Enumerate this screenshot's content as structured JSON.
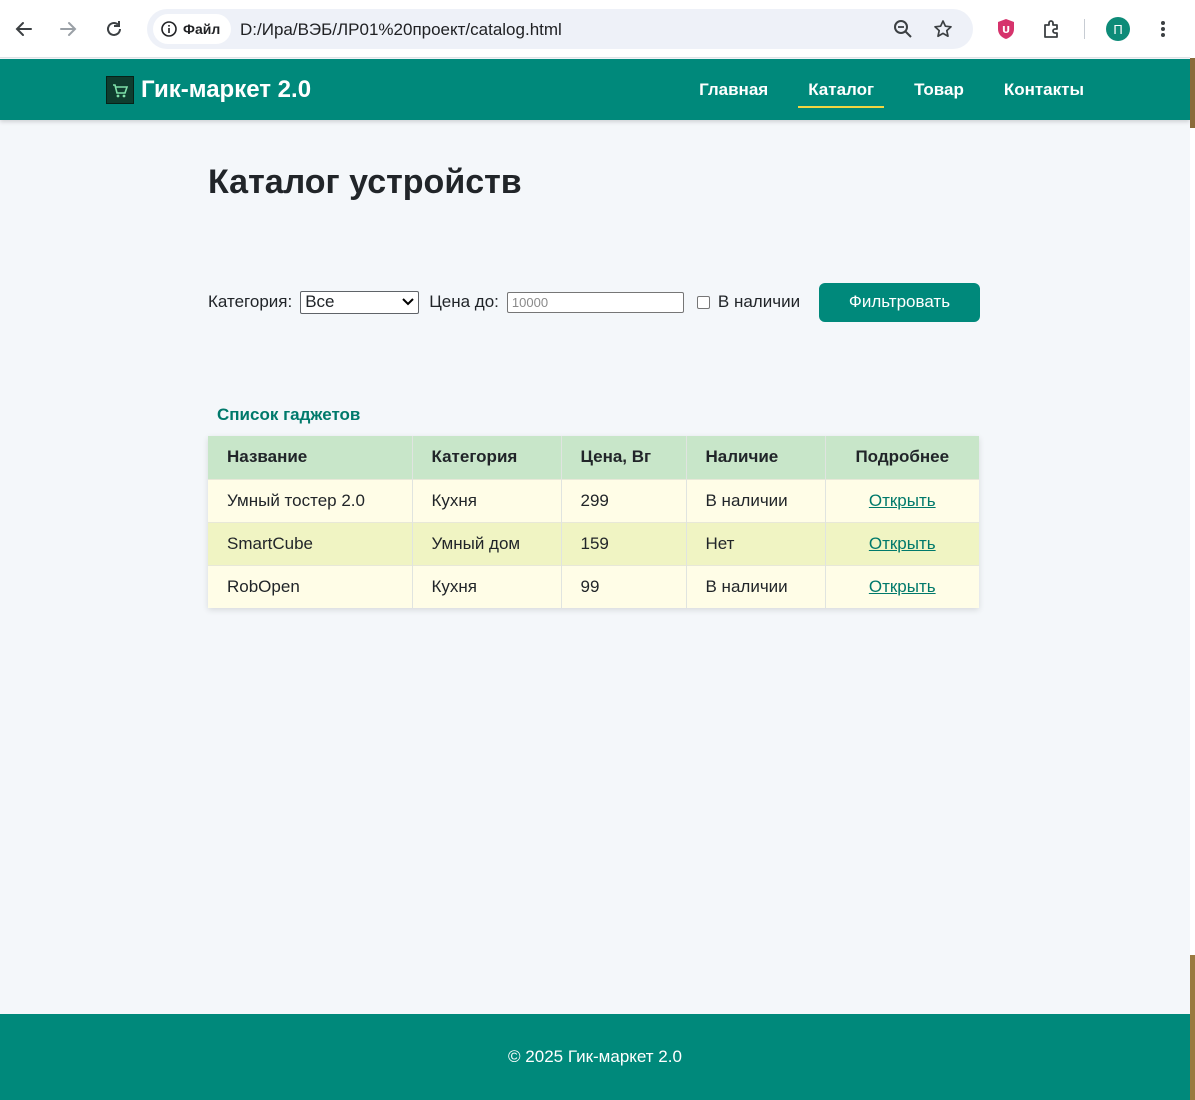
{
  "browser": {
    "site_chip_label": "Файл",
    "url": "D:/Ира/ВЭБ/ЛР01%20проект/catalog.html",
    "profile_initial": "П"
  },
  "header": {
    "brand": "Гик-маркет 2.0",
    "menu": [
      {
        "label": "Главная",
        "active": false
      },
      {
        "label": "Каталог",
        "active": true
      },
      {
        "label": "Товар",
        "active": false
      },
      {
        "label": "Контакты",
        "active": false
      }
    ]
  },
  "main": {
    "title": "Каталог устройств",
    "filters": {
      "category_label": "Категория:",
      "category_value": "Все",
      "price_label": "Цена до:",
      "price_placeholder": "10000",
      "in_stock_label": "В наличии",
      "submit_label": "Фильтровать"
    },
    "table": {
      "caption": "Список гаджетов",
      "headers": [
        "Название",
        "Категория",
        "Цена, Вг",
        "Наличие",
        "Подробнее"
      ],
      "rows": [
        {
          "name": "Умный тостер 2.0",
          "category": "Кухня",
          "price": "299",
          "availability": "В наличии",
          "link": "Открыть"
        },
        {
          "name": "SmartCube",
          "category": "Умный дом",
          "price": "159",
          "availability": "Нет",
          "link": "Открыть"
        },
        {
          "name": "RobOpen",
          "category": "Кухня",
          "price": "99",
          "availability": "В наличии",
          "link": "Открыть"
        }
      ]
    }
  },
  "footer": {
    "text": "© 2025 Гик-маркет 2.0"
  },
  "colors": {
    "primary": "#00897b",
    "accent_underline": "#f2d541",
    "table_header": "#c8e6c9",
    "row_odd": "#fffde7",
    "row_even": "#f0f4c3",
    "link": "#00796b"
  }
}
